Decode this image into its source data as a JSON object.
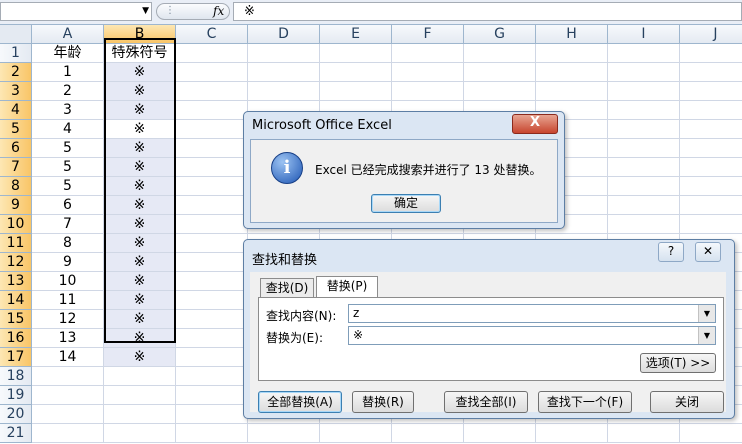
{
  "formula_bar": {
    "name_box": "",
    "fx_label": "fx",
    "content": "※"
  },
  "sheet": {
    "columns": [
      "A",
      "B",
      "C",
      "D",
      "E",
      "F",
      "G",
      "H",
      "I",
      "J"
    ],
    "rows": [
      "1",
      "2",
      "3",
      "4",
      "5",
      "6",
      "7",
      "8",
      "9",
      "10",
      "11",
      "12",
      "13",
      "14",
      "15",
      "16",
      "17",
      "18",
      "19",
      "20",
      "21"
    ],
    "col_a": [
      "年龄",
      "1",
      "2",
      "3",
      "4",
      "5",
      "5",
      "5",
      "6",
      "7",
      "8",
      "9",
      "10",
      "11",
      "12",
      "13",
      "14"
    ],
    "col_b": [
      "特殊符号",
      "※",
      "※",
      "※",
      "※",
      "※",
      "※",
      "※",
      "※",
      "※",
      "※",
      "※",
      "※",
      "※",
      "※",
      "※",
      "※"
    ]
  },
  "msgbox": {
    "title": "Microsoft Office Excel",
    "close": "X",
    "message": "Excel 已经完成搜索并进行了 13 处替换。",
    "ok_label": "确定",
    "info_icon": "i"
  },
  "find_replace": {
    "title": "查找和替换",
    "help": "?",
    "close": "✕",
    "tab_find": "查找(D)",
    "tab_replace": "替换(P)",
    "find_label": "查找内容(N):",
    "find_value": "z",
    "replace_label": "替换为(E):",
    "replace_value": "※",
    "options_label": "选项(T) >>",
    "btn_replace_all": "全部替换(A)",
    "btn_replace": "替换(R)",
    "btn_find_all": "查找全部(I)",
    "btn_find_next": "查找下一个(F)",
    "btn_close": "关闭"
  }
}
